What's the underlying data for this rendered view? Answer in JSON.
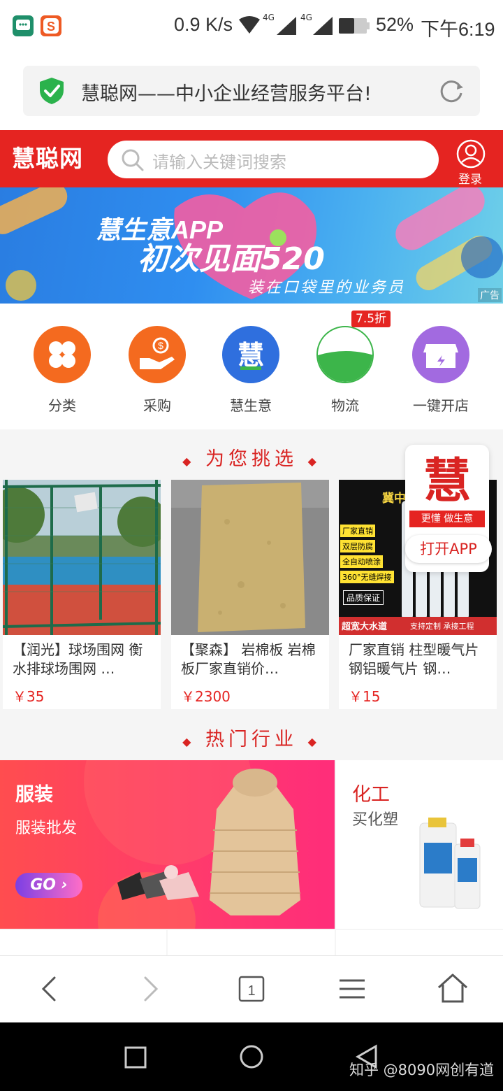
{
  "status_bar": {
    "speed": "0.9 K/s",
    "net1": "4G",
    "net2": "4G",
    "battery": "52%",
    "time": "下午6:19"
  },
  "browser": {
    "page_title": "慧聪网——中小企业经营服务平台!"
  },
  "header": {
    "logo": "慧聪网",
    "search_placeholder": "请输入关键词搜索",
    "login_label": "登录"
  },
  "banner": {
    "title_line1": "慧生意APP",
    "title_line2": "初次见面520",
    "subtitle": "装在口袋里的业务员",
    "ad_tag": "广告"
  },
  "quick_nav": {
    "items": [
      {
        "label": "分类",
        "icon": "clover-icon",
        "color": "#f46a1f"
      },
      {
        "label": "采购",
        "icon": "hand-coin-icon",
        "color": "#f46a1f"
      },
      {
        "label": "慧生意",
        "icon": "hui-logo-icon",
        "color": "#2f6fde"
      },
      {
        "label": "物流",
        "icon": "logistics-icon",
        "color": "#3cb54a"
      },
      {
        "label": "一键开店",
        "icon": "store-icon",
        "color": "#a26ae0"
      }
    ],
    "badge": "7.5折"
  },
  "picks": {
    "title": "为您挑选",
    "products": [
      {
        "title": "【润光】球场围网 衡水排球场围网 …",
        "price": "￥35"
      },
      {
        "title": "【聚森】 岩棉板 岩棉板厂家直销价…",
        "price": "￥2300"
      },
      {
        "title": "厂家直销 柱型暖气片 钢铝暖气片 钢…",
        "price": "￥15"
      }
    ]
  },
  "app_promo": {
    "logo_char": "慧",
    "slogan": "更懂 做生意",
    "button": "打开APP"
  },
  "hot": {
    "title": "热门行业",
    "main": {
      "name": "服装",
      "sub": "服装批发",
      "go": "GO"
    },
    "side": {
      "name": "化工",
      "sub": "买化塑"
    }
  },
  "radiator_image_text": {
    "top": "冀中",
    "tags": [
      "厂家直销",
      "双层防腐",
      "全自动喷涂",
      "360°无缝焊接",
      "品质保证"
    ],
    "bottom_left": "超宽大水道",
    "bottom_right": "支持定制 承接工程"
  },
  "watermark": "知乎 @8090网创有道"
}
